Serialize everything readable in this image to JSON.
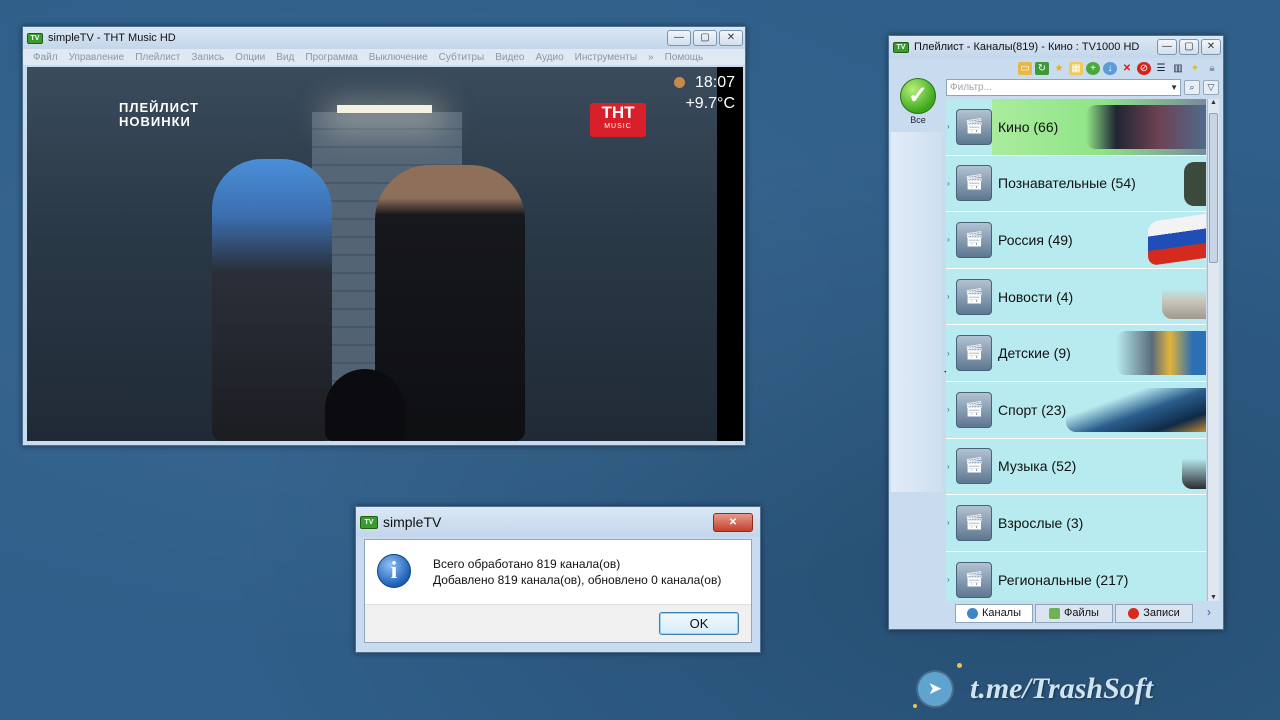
{
  "player": {
    "title": "simpleTV - ТНТ Music HD",
    "menu": [
      "Файл",
      "Управление",
      "Плейлист",
      "Запись",
      "Опции",
      "Вид",
      "Программа",
      "Выключение",
      "Субтитры",
      "Видео",
      "Аудио",
      "Инструменты",
      "»",
      "Помощь"
    ],
    "time": "18:07",
    "temperature": "+9.7°C",
    "overlay_logo_line1": "ПЛЕЙЛИСТ",
    "overlay_logo_line2": "НОВИНКИ",
    "channel_logo_main": "ТНТ",
    "channel_logo_sub": "MUSIC"
  },
  "playlist": {
    "title": "Плейлист - Каналы(819) - Кино : TV1000 HD",
    "filter_placeholder": "Фильтр...",
    "all_label": "Все",
    "groups": [
      {
        "label": "Кино (66)"
      },
      {
        "label": "Познавательные (54)"
      },
      {
        "label": "Россия (49)"
      },
      {
        "label": "Новости (4)"
      },
      {
        "label": "Детские (9)"
      },
      {
        "label": "Спорт (23)"
      },
      {
        "label": "Музыка (52)"
      },
      {
        "label": "Взрослые (3)"
      },
      {
        "label": "Региональные (217)"
      }
    ],
    "tabs": [
      {
        "label": "Каналы",
        "icon": "globe-icon"
      },
      {
        "label": "Файлы",
        "icon": "files-icon"
      },
      {
        "label": "Записи",
        "icon": "record-icon"
      }
    ]
  },
  "dialog": {
    "title": "simpleTV",
    "line1": "Всего обработано 819 канала(ов)",
    "line2": "Добавлено 819 канала(ов), обновлено 0 канала(ов)",
    "ok_label": "OK"
  },
  "watermark": {
    "text": "t.me/TrashSoft"
  },
  "colors": {
    "desktop": "#2f5f8a",
    "group_bg": "#b8ebef",
    "selected_group": "#8fe486",
    "close_button": "#c4402c"
  }
}
